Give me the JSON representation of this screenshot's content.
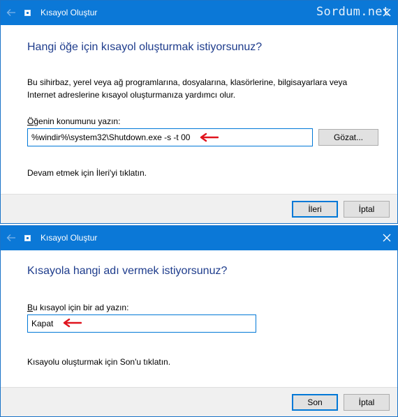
{
  "watermark": "Sordum.net",
  "window1": {
    "title": "Kısayol Oluştur",
    "heading": "Hangi öğe için kısayol oluşturmak istiyorsunuz?",
    "description": "Bu sihirbaz, yerel veya ağ programlarına, dosyalarına, klasörlerine, bilgisayarlara veya Internet adreslerine kısayol oluşturmanıza yardımcı olur.",
    "location_label": "Öğenin konumunu yazın:",
    "location_value": "%windir%\\system32\\Shutdown.exe -s -t 00",
    "browse_label": "Gözat...",
    "hint": "Devam etmek için İleri'yi tıklatın.",
    "next_label": "İleri",
    "cancel_label": "İptal"
  },
  "window2": {
    "title": "Kısayol Oluştur",
    "heading": "Kısayola hangi adı vermek istiyorsunuz?",
    "name_label": "Bu kısayol için bir ad yazın:",
    "name_value": "Kapat",
    "hint": "Kısayolu oluşturmak için Son'u tıklatın.",
    "finish_label": "Son",
    "cancel_label": "İptal"
  },
  "colors": {
    "titlebar": "#0b78d7",
    "heading": "#1e3c8c",
    "accent": "#0078d7",
    "annotation_arrow": "#e0141e"
  },
  "icons": [
    "back-arrow-icon",
    "shortcut-app-icon",
    "close-icon",
    "red-annotation-arrow-icon"
  ]
}
